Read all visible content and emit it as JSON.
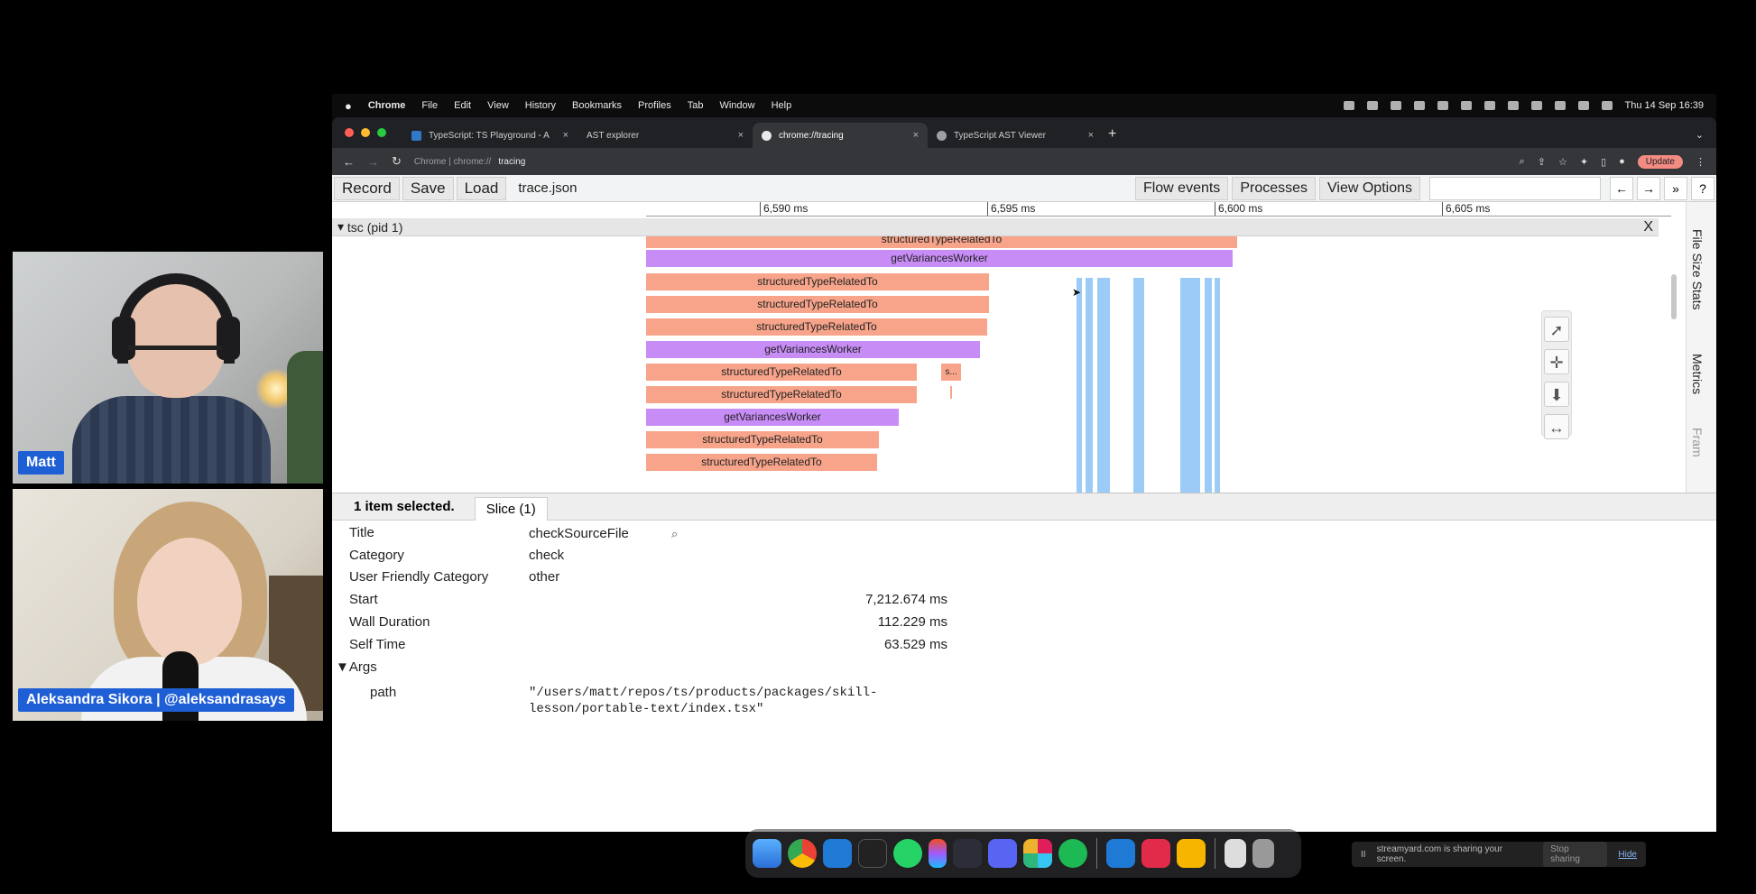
{
  "webcams": {
    "host_name": "Matt",
    "guest_name": "Aleksandra Sikora | @aleksandrasays"
  },
  "menubar": {
    "apple": "",
    "app": "Chrome",
    "items": [
      "File",
      "Edit",
      "View",
      "History",
      "Bookmarks",
      "Profiles",
      "Tab",
      "Window",
      "Help"
    ],
    "datetime": "Thu 14 Sep 16:39"
  },
  "browser": {
    "tabs": [
      {
        "title": "TypeScript: TS Playground - A"
      },
      {
        "title": "AST explorer"
      },
      {
        "title": "chrome://tracing"
      },
      {
        "title": "TypeScript AST Viewer"
      }
    ],
    "new_tab": "+",
    "url_prefix": "Chrome | chrome://",
    "url_path": "tracing",
    "update_label": "Update"
  },
  "toolbar": {
    "record": "Record",
    "save": "Save",
    "load": "Load",
    "file": "trace.json",
    "flow_events": "Flow events",
    "processes": "Processes",
    "view_options": "View Options",
    "prev": "←",
    "next": "→",
    "more": "»",
    "help": "?"
  },
  "timeline": {
    "ticks": [
      "6,590 ms",
      "6,595 ms",
      "6,600 ms",
      "6,605 ms"
    ],
    "process": "tsc (pid 1)",
    "close": "X",
    "side_tabs": [
      "File Size Stats",
      "Metrics",
      "Fram"
    ],
    "slices": [
      {
        "label": "structuredTypeRelatedTo"
      },
      {
        "label": "getVariancesWorker"
      },
      {
        "label": "structuredTypeRelatedTo"
      },
      {
        "label": "structuredTypeRelatedTo"
      },
      {
        "label": "structuredTypeRelatedTo"
      },
      {
        "label": "getVariancesWorker"
      },
      {
        "label": "structuredTypeRelatedTo"
      },
      {
        "label": "s..."
      },
      {
        "label": "structuredTypeRelatedTo"
      },
      {
        "label": "getVariancesWorker"
      },
      {
        "label": "structuredTypeRelatedTo"
      },
      {
        "label": "structuredTypeRelatedTo"
      }
    ]
  },
  "details": {
    "selected": "1 item selected.",
    "tab": "Slice (1)",
    "rows": {
      "title_label": "Title",
      "title_value": "checkSourceFile",
      "category_label": "Category",
      "category_value": "check",
      "ufc_label": "User Friendly Category",
      "ufc_value": "other",
      "start_label": "Start",
      "start_value": "7,212.674 ms",
      "wall_label": "Wall Duration",
      "wall_value": "112.229 ms",
      "self_label": "Self Time",
      "self_value": "63.529 ms",
      "args_label": "▼Args",
      "path_label": "path",
      "path_line1": "\"/users/matt/repos/ts/products/packages/skill-",
      "path_line2": "lesson/portable-text/index.tsx\""
    }
  },
  "share_bar": {
    "text": "streamyard.com is sharing your screen.",
    "stop": "Stop sharing",
    "hide": "Hide"
  },
  "colors": {
    "slice_pink": "#f7a48a",
    "slice_purple": "#c78cf5",
    "slice_blue": "#9ccbf7",
    "name_tag": "#1f5fd6"
  }
}
